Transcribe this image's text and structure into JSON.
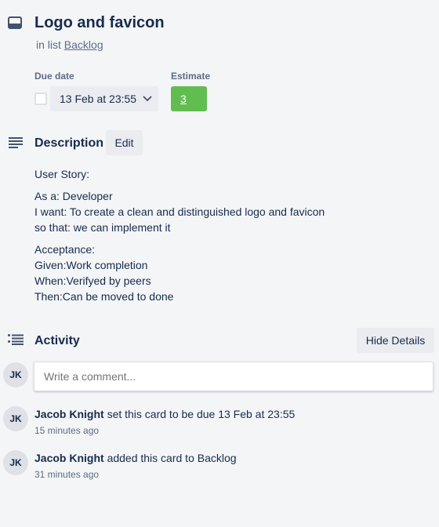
{
  "card": {
    "title": "Logo and favicon",
    "in_list_prefix": "in list",
    "list_name": "Backlog",
    "icon": "card-icon"
  },
  "due_date": {
    "label": "Due date",
    "value": "13 Feb at 23:55",
    "checked": false
  },
  "estimate": {
    "label": "Estimate",
    "value": "3",
    "color": "#61bd4f"
  },
  "description": {
    "title": "Description",
    "edit_label": "Edit",
    "paragraphs": [
      "User Story:",
      "As a: Developer\nI want: To create a clean and distinguished logo and favicon\nso that: we can implement it",
      "Acceptance:\nGiven:Work completion\nWhen:Verifyed by peers\nThen:Can be moved to done"
    ]
  },
  "activity": {
    "title": "Activity",
    "hide_details_label": "Hide Details",
    "comment_placeholder": "Write a comment...",
    "user_initials": "JK",
    "entries": [
      {
        "initials": "JK",
        "user": "Jacob Knight",
        "text": "set this card to be due 13 Feb at 23:55",
        "time": "15 minutes ago"
      },
      {
        "initials": "JK",
        "user": "Jacob Knight",
        "text": "added this card to Backlog",
        "time": "31 minutes ago"
      }
    ]
  }
}
